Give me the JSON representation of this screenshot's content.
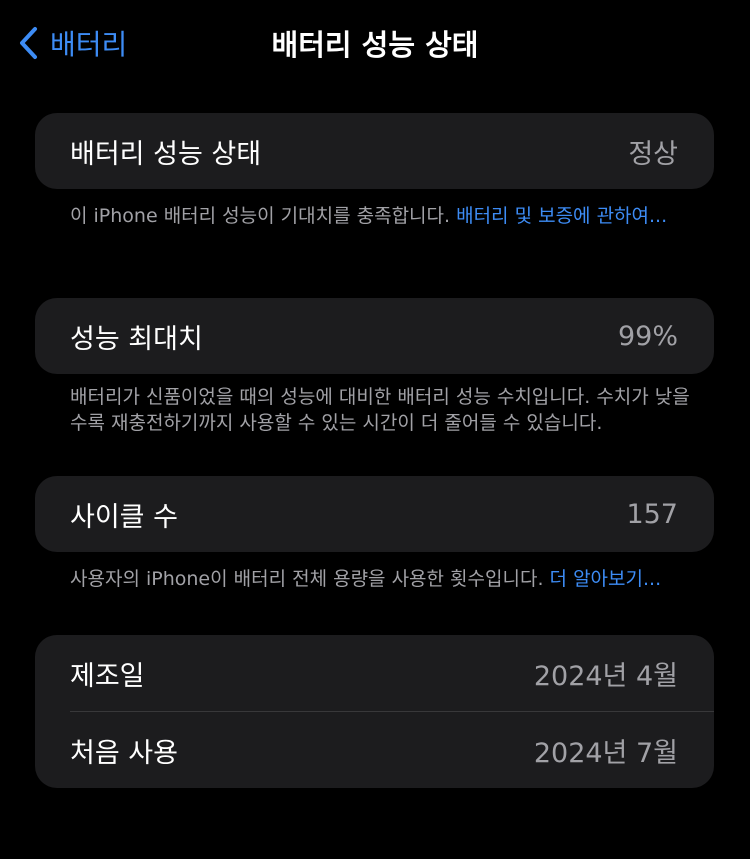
{
  "nav": {
    "back_label": "배터리",
    "title": "배터리 성능 상태"
  },
  "health": {
    "label": "배터리 성능 상태",
    "value": "정상",
    "note_text": "이 iPhone 배터리 성능이 기대치를 충족합니다. ",
    "note_link": "배터리 및 보증에 관하여..."
  },
  "capacity": {
    "label": "성능 최대치",
    "value": "99%",
    "note_text": "배터리가 신품이었을 때의 성능에 대비한 배터리 성능 수치입니다. 수치가 낮을수록 재충전하기까지 사용할 수 있는 시간이 더 줄어들 수 있습니다."
  },
  "cycles": {
    "label": "사이클 수",
    "value": "157",
    "note_text": "사용자의 iPhone이 배터리 전체 용량을 사용한 횟수입니다. ",
    "note_link": "더 알아보기..."
  },
  "dates": {
    "manufacture_label": "제조일",
    "manufacture_value": "2024년 4월",
    "first_use_label": "처음 사용",
    "first_use_value": "2024년 7월"
  },
  "colors": {
    "background": "#000000",
    "card": "#1c1c1e",
    "accent": "#3d8cf5",
    "secondary_text": "#a1a1a6"
  },
  "icons": {
    "back": "chevron-left-icon"
  }
}
